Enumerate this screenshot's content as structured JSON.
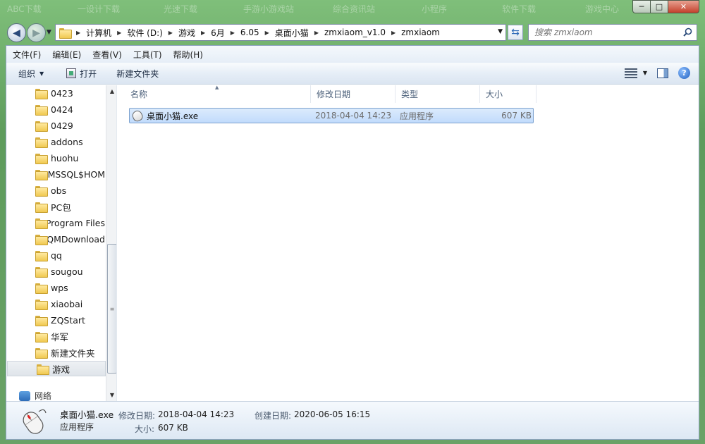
{
  "window": {
    "caption": {
      "minimize": "─",
      "maximize": "□",
      "close": "✕"
    },
    "background_tabs": [
      "ABC下载",
      "一设计下载",
      "光速下载",
      "手游小游戏站",
      "综合资讯站",
      "小程序",
      "软件下载",
      "游戏中心"
    ]
  },
  "address_bar": {
    "crumbs": [
      "计算机",
      "软件 (D:)",
      "游戏",
      "6月",
      "6.05",
      "桌面小猫",
      "zmxiaom_v1.0",
      "zmxiaom"
    ]
  },
  "search": {
    "placeholder": "搜索 zmxiaom"
  },
  "menubar": {
    "items": [
      "文件(F)",
      "编辑(E)",
      "查看(V)",
      "工具(T)",
      "帮助(H)"
    ]
  },
  "toolbar": {
    "organize": "组织",
    "open": "打开",
    "new_folder": "新建文件夹"
  },
  "nav_tree": {
    "items": [
      "0423",
      "0424",
      "0429",
      "addons",
      "huohu",
      "MSSQL$HOM",
      "obs",
      "PC包",
      "Program Files",
      "QMDownload",
      "qq",
      "sougou",
      "wps",
      "xiaobai",
      "ZQStart",
      "华军",
      "新建文件夹",
      "游戏"
    ],
    "selected": "游戏",
    "network_label": "网络"
  },
  "columns": {
    "name": "名称",
    "modified": "修改日期",
    "type": "类型",
    "size": "大小"
  },
  "files": [
    {
      "name": "桌面小猫.exe",
      "modified": "2018-04-04 14:23",
      "type": "应用程序",
      "size": "607 KB"
    }
  ],
  "details": {
    "name": "桌面小猫.exe",
    "type": "应用程序",
    "modified_label": "修改日期:",
    "modified_value": "2018-04-04 14:23",
    "created_label": "创建日期:",
    "created_value": "2020-06-05 16:15",
    "size_label": "大小:",
    "size_value": "607 KB"
  }
}
